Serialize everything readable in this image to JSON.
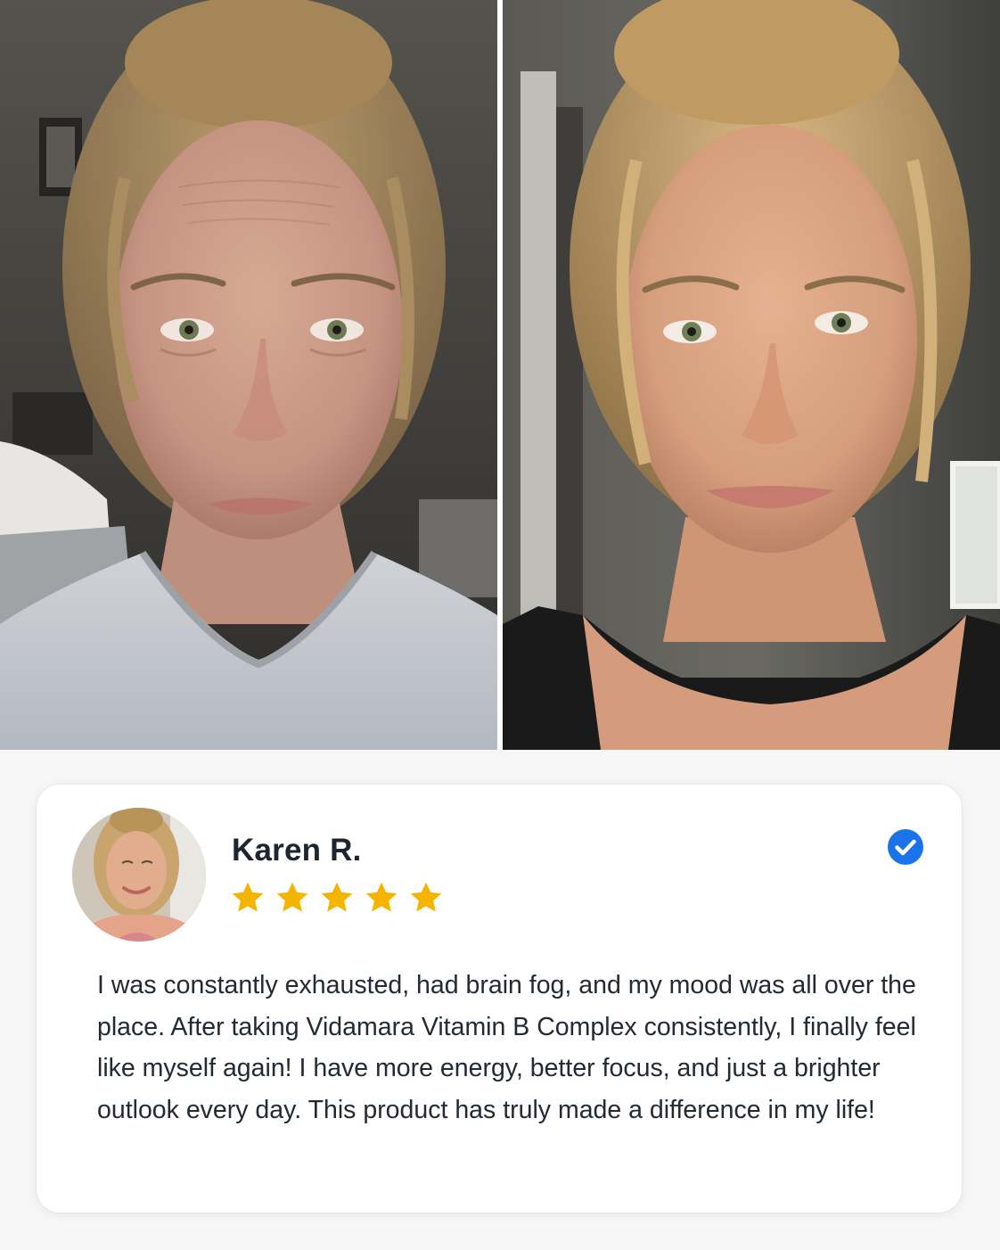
{
  "photos": {
    "before_label": "",
    "after_label": ""
  },
  "review": {
    "name": "Karen R.",
    "rating": 5,
    "rating_max": 5,
    "verified": true,
    "text": "I was constantly exhausted, had brain fog, and my mood was all over the place. After taking Vidamara Vitamin B Complex consistently, I finally feel like myself again! I have more energy, better focus, and just a brighter outlook every day. This product has truly made a difference in my life!"
  },
  "colors": {
    "star": "#f5b400",
    "verified_badge": "#1a73e8",
    "name_text": "#1c2530",
    "body_text": "#222a33",
    "card_bg": "#ffffff",
    "page_bg": "#f7f7f7"
  },
  "icons": {
    "star": "star-icon",
    "verified": "verified-check-icon"
  }
}
